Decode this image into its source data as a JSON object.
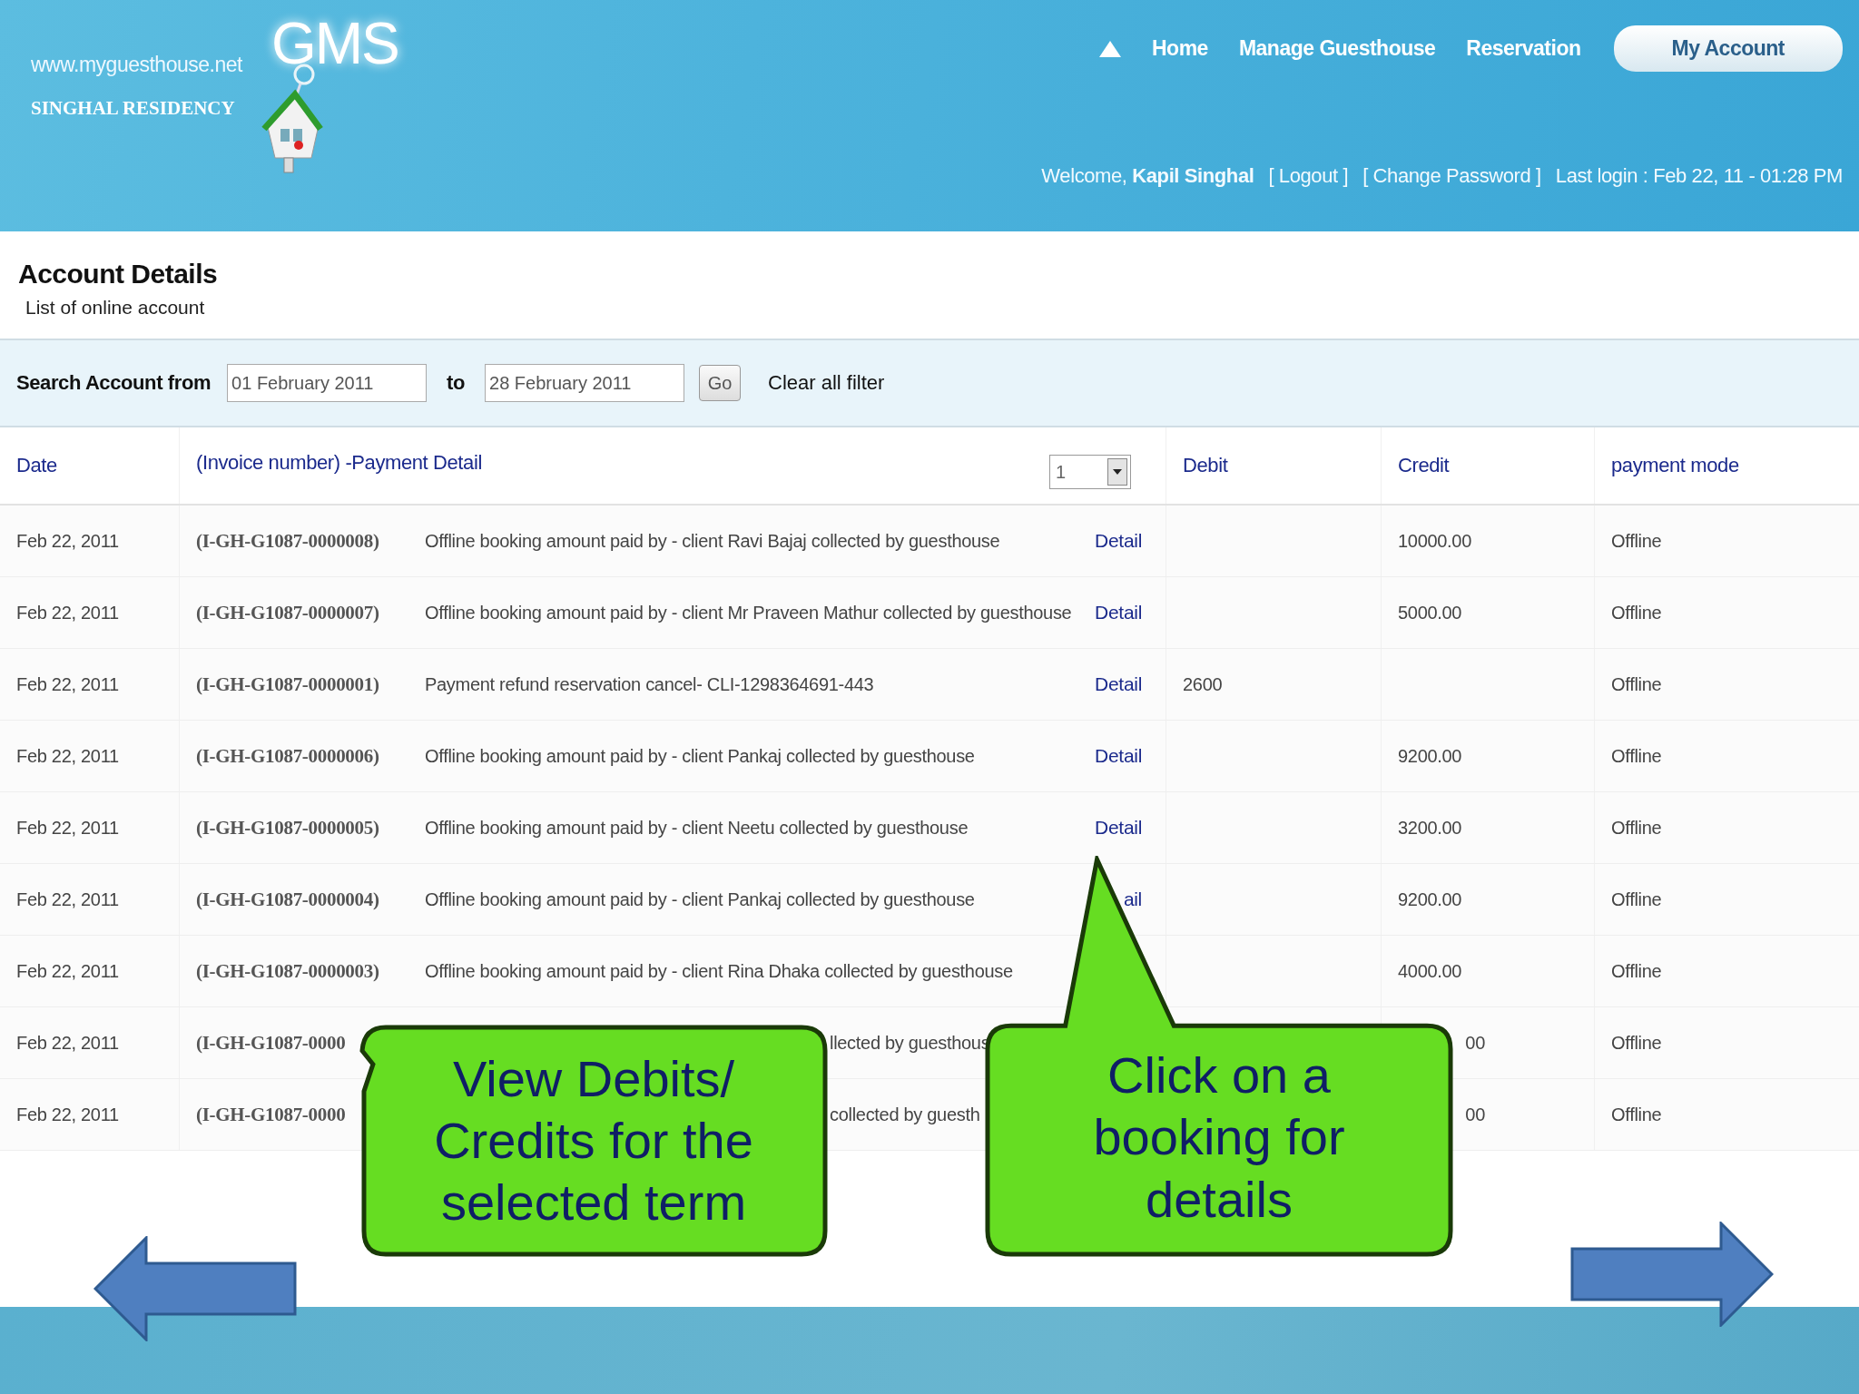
{
  "site": {
    "url": "www.myguesthouse.net",
    "name": "SINGHAL RESIDENCY",
    "logo_text": "GMS"
  },
  "nav": [
    {
      "label": "Home",
      "selected": false
    },
    {
      "label": "Manage Guesthouse",
      "selected": false
    },
    {
      "label": "Reservation",
      "selected": false
    },
    {
      "label": "My Account",
      "selected": true
    }
  ],
  "user_bar": {
    "welcome": "Welcome, **Kapil Singhal**",
    "logout": "[ Logout ]",
    "change_password": "[ Change Password ]",
    "last_login": "Last login : Feb 22, 11 - 01:28 PM"
  },
  "page": {
    "title": "Account Details",
    "subtitle": "List of online account"
  },
  "search": {
    "label": "Search Account from",
    "from": "01 February 2011",
    "to_label": "to",
    "to": "28 February 2011",
    "go": "Go",
    "clear": "Clear all filter"
  },
  "table": {
    "columns": [
      "Date",
      "(Invoice number) -Payment Detail",
      "Debit",
      "Credit",
      "payment mode"
    ],
    "page_select": "1",
    "rows": [
      {
        "kind": "full",
        "date": "Feb 22, 2011",
        "invoice": "(I-GH-G1087-0000008)",
        "description": "Offline booking amount paid by - client Ravi Bajaj collected by guesthouse",
        "detail": "Detail",
        "debit": "",
        "credit": "10000.00",
        "mode": "Offline"
      },
      {
        "kind": "full",
        "date": "Feb 22, 2011",
        "invoice": "(I-GH-G1087-0000007)",
        "description": "Offline booking amount paid by - client Mr Praveen Mathur collected by guesthouse",
        "detail": "Detail",
        "debit": "",
        "credit": "5000.00",
        "mode": "Offline"
      },
      {
        "kind": "full",
        "date": "Feb 22, 2011",
        "invoice": "(I-GH-G1087-0000001)",
        "description": "Payment refund reservation cancel- CLI-1298364691-443",
        "detail": "Detail",
        "debit": "2600",
        "credit": "",
        "mode": "Offline"
      },
      {
        "kind": "full",
        "date": "Feb 22, 2011",
        "invoice": "(I-GH-G1087-0000006)",
        "description": "Offline booking amount paid by - client Pankaj collected by guesthouse",
        "detail": "Detail",
        "debit": "",
        "credit": "9200.00",
        "mode": "Offline"
      },
      {
        "kind": "full",
        "date": "Feb 22, 2011",
        "invoice": "(I-GH-G1087-0000005)",
        "description": "Offline booking amount paid by - client Neetu collected by guesthouse",
        "detail": "Detail",
        "debit": "",
        "credit": "3200.00",
        "mode": "Offline"
      },
      {
        "kind": "full",
        "date": "Feb 22, 2011",
        "invoice": "(I-GH-G1087-0000004)",
        "description": "Offline booking amount paid by - client Pankaj collected by guesthouse",
        "detail": "ail",
        "debit": "",
        "credit": "9200.00",
        "mode": "Offline"
      },
      {
        "kind": "full",
        "date": "Feb 22, 2011",
        "invoice": "(I-GH-G1087-0000003)",
        "description": "Offline booking amount paid by - client Rina Dhaka collected by guesthouse",
        "detail": "",
        "debit": "",
        "credit": "4000.00",
        "mode": "Offline"
      },
      {
        "kind": "covered",
        "date": "Feb 22, 2011",
        "invoice": "(I-GH-G1087-0000",
        "description": "llected by guesthous",
        "detail": "",
        "debit": "",
        "credit": "00",
        "mode": "Offline"
      },
      {
        "kind": "covered",
        "date": "Feb 22, 2011",
        "invoice": "(I-GH-G1087-0000",
        "description": "collected by guesth",
        "detail": "",
        "debit": "",
        "credit": "00",
        "mode": "Offline"
      }
    ]
  },
  "callouts": [
    {
      "kind": "left",
      "text": "View Debits/ Credits for the selected term"
    },
    {
      "kind": "top",
      "text": "Click on a booking for details"
    }
  ]
}
